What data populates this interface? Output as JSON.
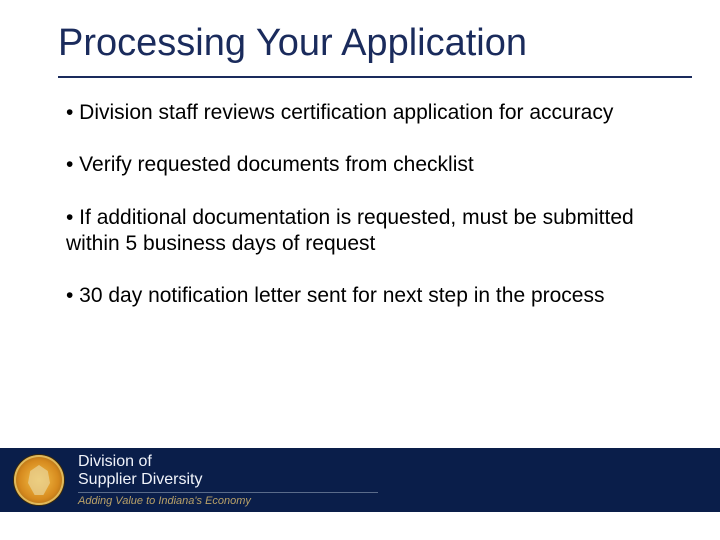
{
  "title": "Processing Your Application",
  "bullets": [
    "• Division staff reviews certification application for accuracy",
    "• Verify requested documents from checklist",
    "• If additional documentation is requested, must be submitted within 5 business days of request",
    "• 30 day notification letter sent for next step in the process"
  ],
  "footer": {
    "line1": "Division of",
    "line2": "Supplier Diversity",
    "tagline": "Adding Value to Indiana's Economy"
  },
  "colors": {
    "title": "#1a2b5c",
    "band": "#0a1e4a",
    "tagline": "#b9a168"
  }
}
